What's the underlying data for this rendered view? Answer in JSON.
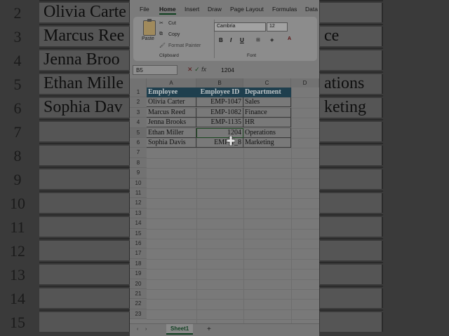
{
  "background": {
    "rows": [
      {
        "num": "2",
        "a": "Olivia Carte",
        "c": ""
      },
      {
        "num": "3",
        "a": "Marcus Ree",
        "c": "ce"
      },
      {
        "num": "4",
        "a": "Jenna Broo",
        "c": ""
      },
      {
        "num": "5",
        "a": "Ethan Mille",
        "c": "ations"
      },
      {
        "num": "6",
        "a": "Sophia Dav",
        "c": "keting"
      },
      {
        "num": "7",
        "a": "",
        "c": ""
      },
      {
        "num": "8",
        "a": "",
        "c": ""
      },
      {
        "num": "9",
        "a": "",
        "c": ""
      },
      {
        "num": "10",
        "a": "",
        "c": ""
      },
      {
        "num": "11",
        "a": "",
        "c": ""
      },
      {
        "num": "12",
        "a": "",
        "c": ""
      },
      {
        "num": "13",
        "a": "",
        "c": ""
      },
      {
        "num": "14",
        "a": "",
        "c": ""
      },
      {
        "num": "15",
        "a": "",
        "c": ""
      }
    ]
  },
  "ribbon": {
    "tabs": [
      "File",
      "Home",
      "Insert",
      "Draw",
      "Page Layout",
      "Formulas",
      "Data"
    ],
    "active_tab": "Home",
    "paste_label": "Paste",
    "cut_label": "Cut",
    "copy_label": "Copy",
    "format_painter_label": "Format Painter",
    "clipboard_label": "Clipboard",
    "font_label": "Font",
    "font_name": "Cambria",
    "font_size": "12",
    "bold": "B",
    "italic": "I",
    "underline": "U"
  },
  "formula_bar": {
    "name_box": "B5",
    "fx": "fx",
    "value": "1204"
  },
  "grid": {
    "columns": [
      "A",
      "B",
      "C",
      "D"
    ],
    "row_numbers": [
      "1",
      "2",
      "3",
      "4",
      "5",
      "6",
      "7",
      "8",
      "9",
      "10",
      "11",
      "12",
      "13",
      "14",
      "15",
      "16",
      "17",
      "18",
      "19",
      "20",
      "21",
      "22",
      "23"
    ],
    "header": [
      "Employee",
      "Employee ID",
      "Department"
    ],
    "rows": [
      [
        "Olivia Carter",
        "EMP-1047",
        "Sales"
      ],
      [
        "Marcus Reed",
        "EMP-1082",
        "Finance"
      ],
      [
        "Jenna Brooks",
        "EMP-1135",
        "HR"
      ],
      [
        "Ethan Miller",
        "1204",
        "Operations"
      ],
      [
        "Sophia Davis",
        "EMP-1_8",
        "Marketing"
      ]
    ]
  },
  "sheets": {
    "active": "Sheet1",
    "add_label": "+"
  },
  "colors": {
    "header_fill": "#1f3f4e",
    "accent": "#0f3f20"
  }
}
